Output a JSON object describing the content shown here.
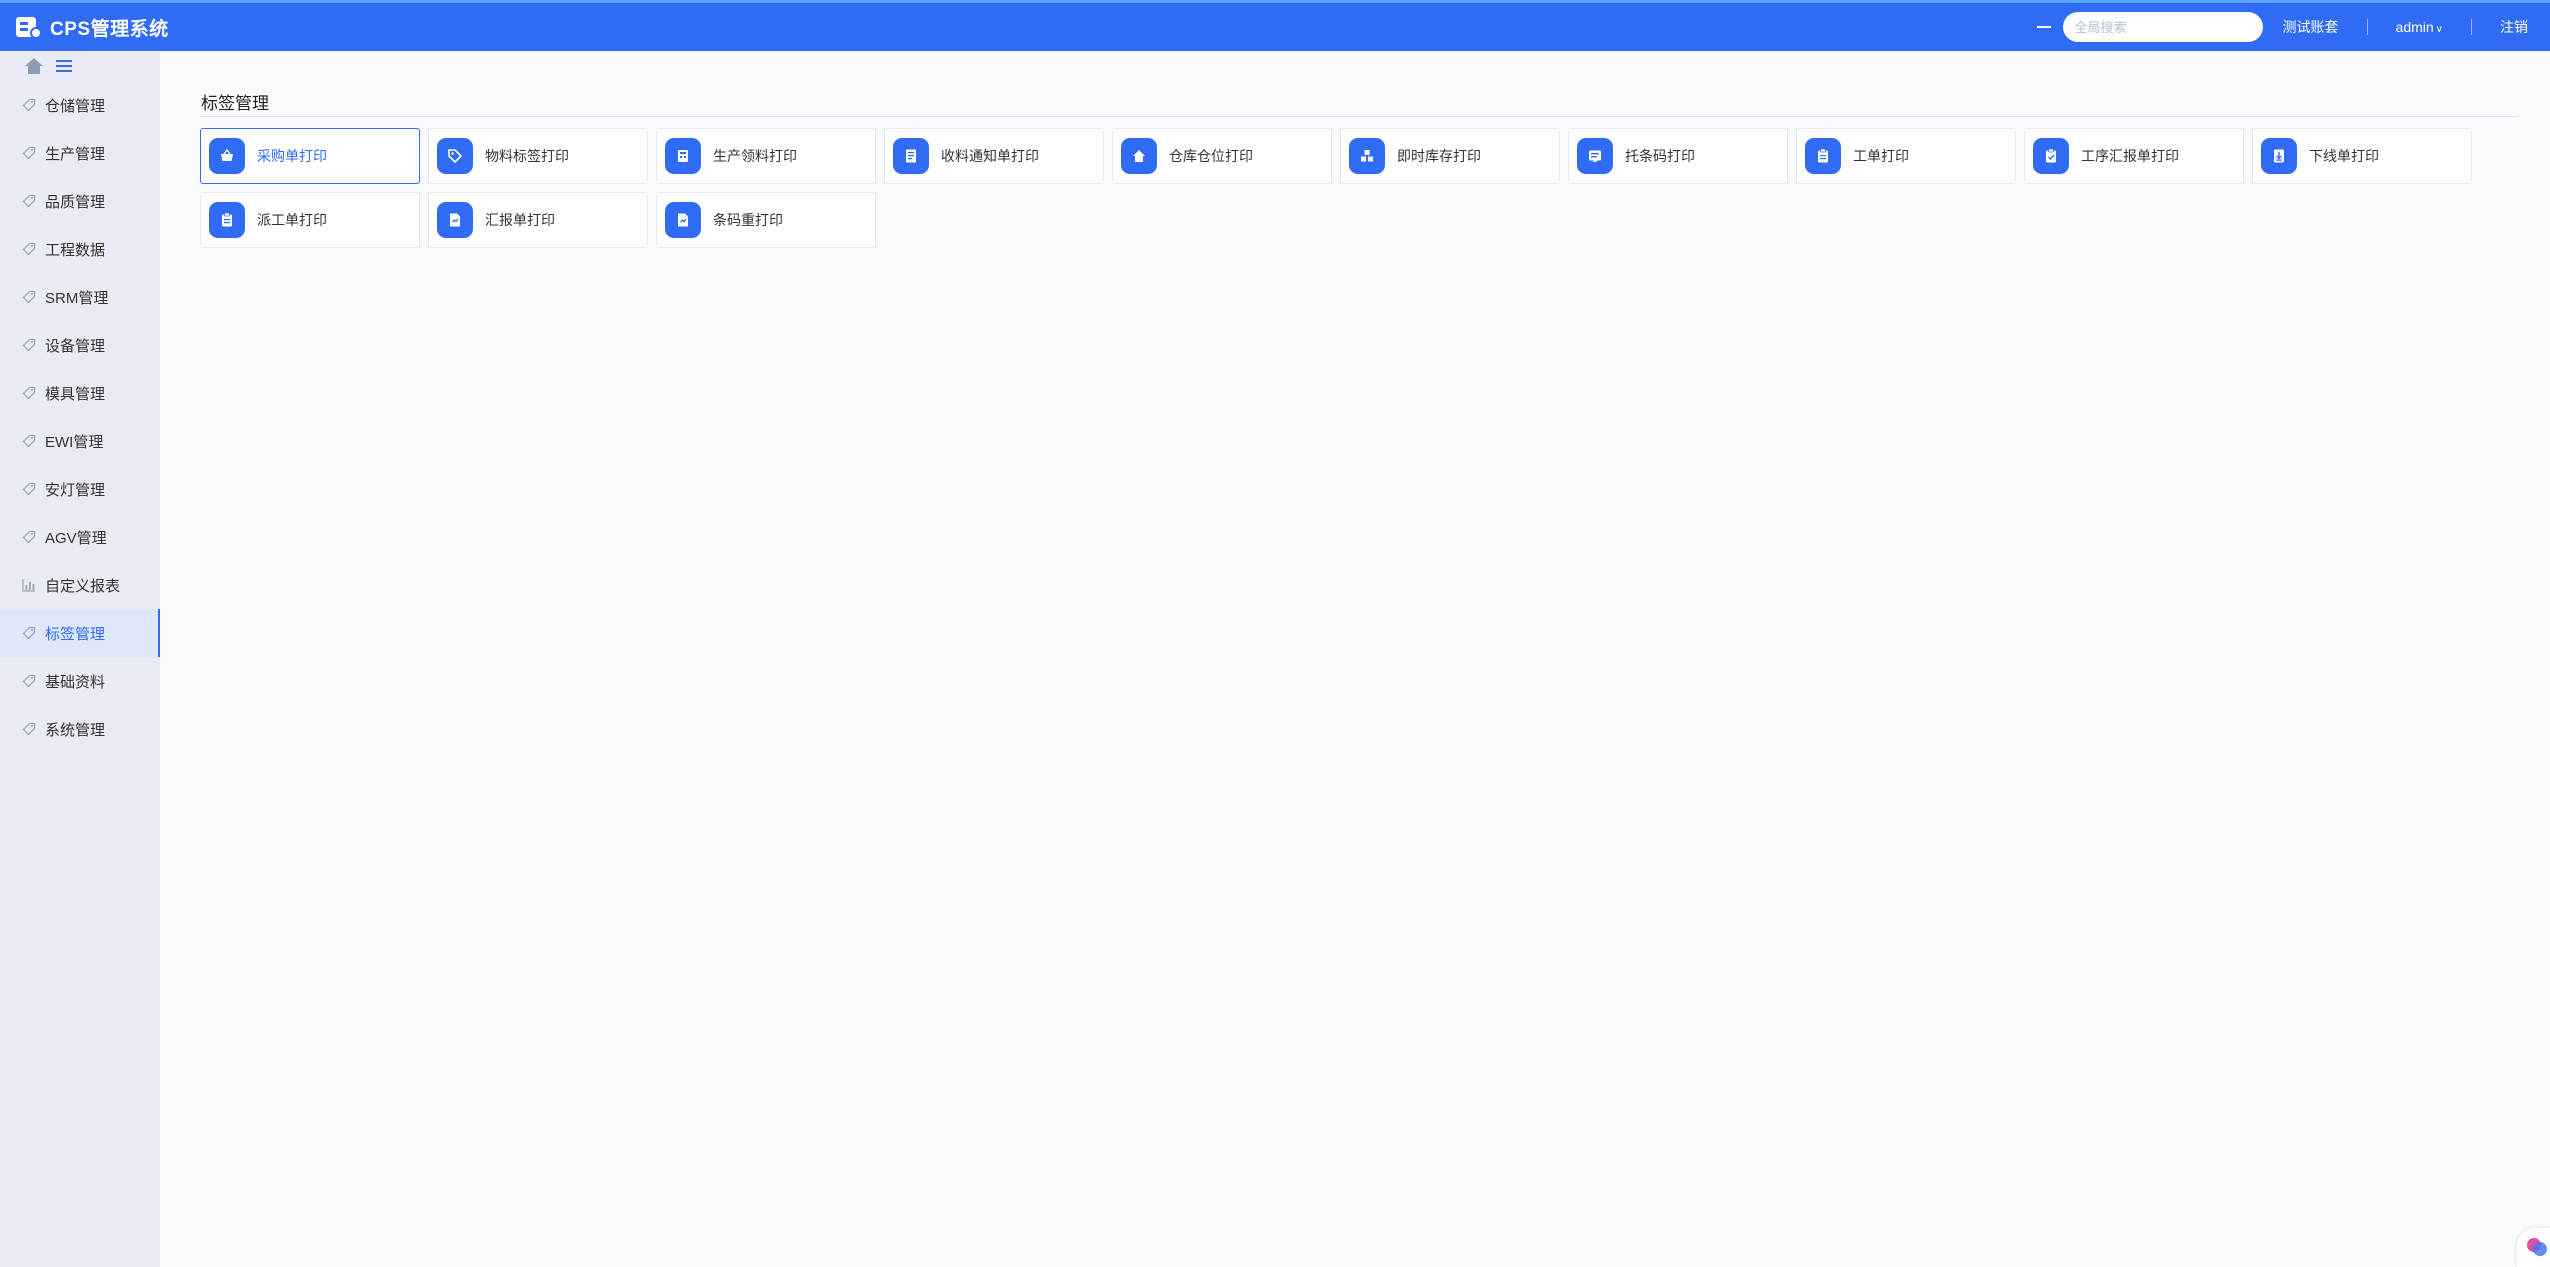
{
  "app": {
    "title": "CPS管理系统"
  },
  "topbar": {
    "search_placeholder": "全局搜索",
    "account_set": "测试账套",
    "user": "admin",
    "logout": "注销"
  },
  "sidebar": {
    "items": [
      {
        "label": "仓储管理",
        "icon": "tag-icon"
      },
      {
        "label": "生产管理",
        "icon": "tag-icon"
      },
      {
        "label": "品质管理",
        "icon": "tag-icon"
      },
      {
        "label": "工程数据",
        "icon": "tag-icon"
      },
      {
        "label": "SRM管理",
        "icon": "tag-icon"
      },
      {
        "label": "设备管理",
        "icon": "tag-icon"
      },
      {
        "label": "模具管理",
        "icon": "tag-icon"
      },
      {
        "label": "EWI管理",
        "icon": "tag-icon"
      },
      {
        "label": "安灯管理",
        "icon": "tag-icon"
      },
      {
        "label": "AGV管理",
        "icon": "tag-icon"
      },
      {
        "label": "自定义报表",
        "icon": "chart-icon"
      },
      {
        "label": "标签管理",
        "icon": "tag-icon",
        "active": true
      },
      {
        "label": "基础资料",
        "icon": "tag-icon"
      },
      {
        "label": "系统管理",
        "icon": "tag-icon"
      }
    ]
  },
  "main": {
    "title": "标签管理",
    "cards": [
      {
        "label": "采购单打印",
        "icon": "basket-icon",
        "selected": true
      },
      {
        "label": "物料标签打印",
        "icon": "tag-icon"
      },
      {
        "label": "生产领料打印",
        "icon": "calculator-icon"
      },
      {
        "label": "收料通知单打印",
        "icon": "document-icon"
      },
      {
        "label": "仓库仓位打印",
        "icon": "house-icon"
      },
      {
        "label": "即时库存打印",
        "icon": "boxes-icon"
      },
      {
        "label": "托条码打印",
        "icon": "monitor-icon"
      },
      {
        "label": "工单打印",
        "icon": "clipboard-icon"
      },
      {
        "label": "工序汇报单打印",
        "icon": "clipboard-check-icon"
      },
      {
        "label": "下线单打印",
        "icon": "download-doc-icon"
      },
      {
        "label": "派工单打印",
        "icon": "clipboard-icon"
      },
      {
        "label": "汇报单打印",
        "icon": "report-icon"
      },
      {
        "label": "条码重打印",
        "icon": "report-icon"
      }
    ]
  },
  "colors": {
    "primary": "#2f6bf5",
    "sidebar_bg": "#e9ecf4",
    "page_bg": "#f9fbfe"
  }
}
